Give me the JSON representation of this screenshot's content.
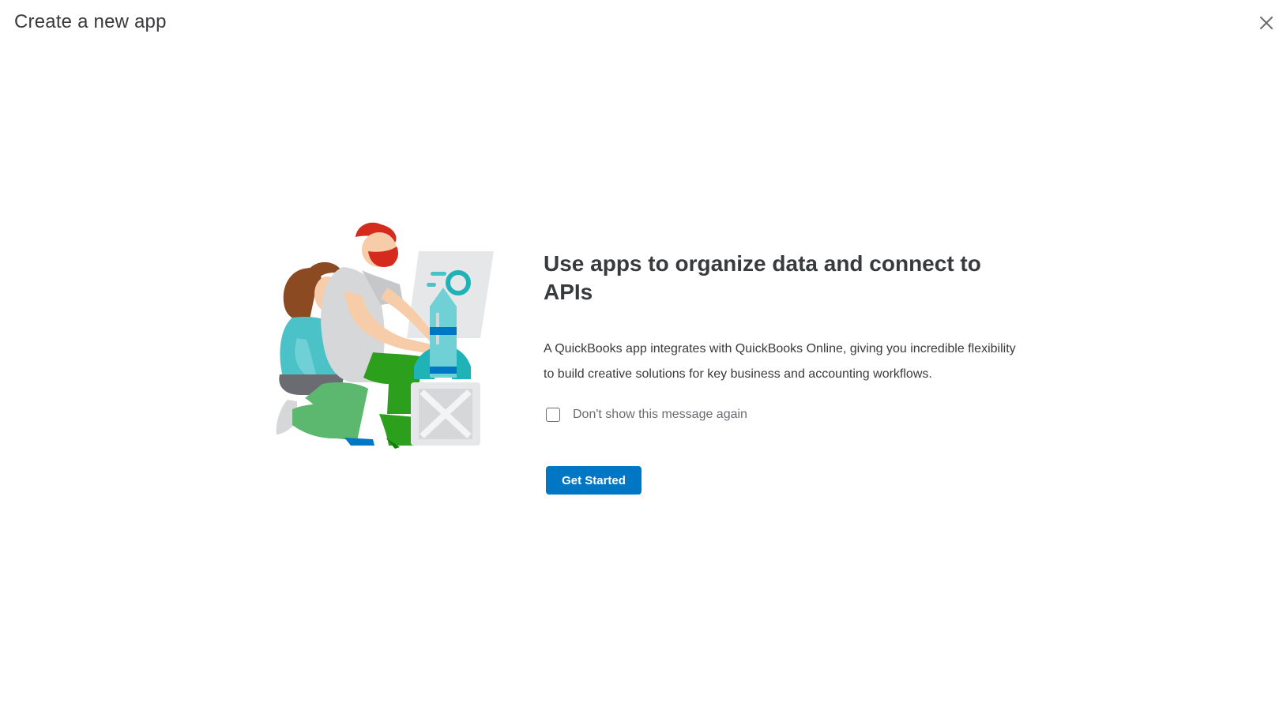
{
  "header": {
    "title": "Create a new app",
    "close_icon": "close-icon"
  },
  "illustration": {
    "icon": "team-building-rocket-illustration"
  },
  "main": {
    "headline": "Use apps to organize data and connect to APIs",
    "description": "A QuickBooks app integrates with QuickBooks Online, giving you incredible flexibility to build creative solutions for key business and accounting workflows.",
    "checkbox": {
      "label": "Don't show this message again",
      "checked": false
    },
    "primary_button_label": "Get Started"
  },
  "colors": {
    "primary": "#0077c5",
    "text": "#393a3d",
    "muted_text": "#6b6c72"
  }
}
